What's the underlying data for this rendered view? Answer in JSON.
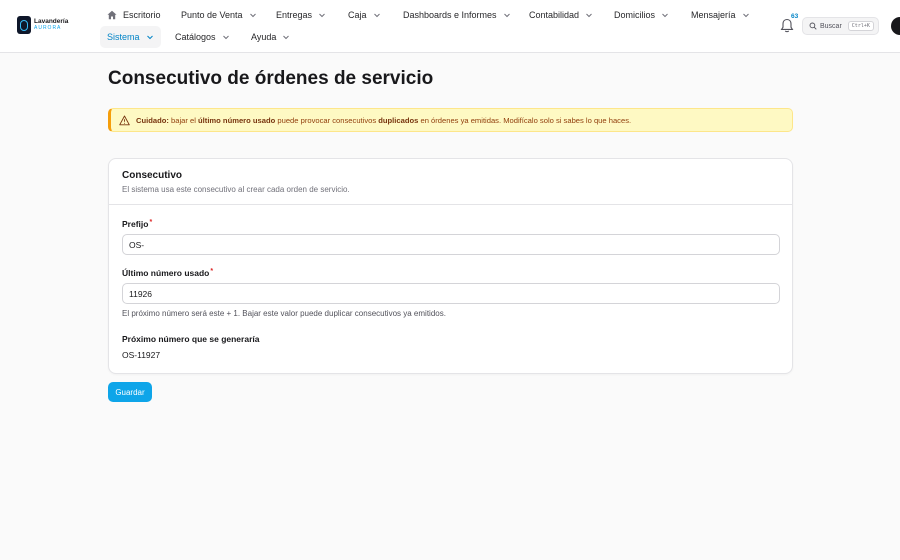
{
  "brand": {
    "line1": "Lavandería",
    "line2": "AURORA"
  },
  "nav": {
    "home": "Escritorio",
    "items": [
      "Punto de Venta",
      "Entregas",
      "Caja",
      "Dashboards e Informes",
      "Contabilidad",
      "Domicilios",
      "Mensajería",
      "Sistema",
      "Catálogos",
      "Ayuda"
    ],
    "active_item": "Sistema"
  },
  "notifications": {
    "count": "63"
  },
  "search": {
    "label": "Buscar",
    "shortcut": "Ctrl+K"
  },
  "page": {
    "title": "Consecutivo de órdenes de servicio"
  },
  "alert": {
    "prefix": "Cuidado:",
    "t1": " bajar el ",
    "strong1": "último número usado",
    "t2": " puede provocar consecutivos ",
    "strong2": "duplicados",
    "t3": " en órdenes ya emitidas. Modifícalo solo si sabes lo que haces."
  },
  "card": {
    "title": "Consecutivo",
    "description": "El sistema usa este consecutivo al crear cada orden de servicio."
  },
  "form": {
    "prefix_label": "Prefijo",
    "prefix_value": "OS-",
    "last_label": "Último número usado",
    "last_value": "11926",
    "last_hint": "El próximo número será este + 1. Bajar este valor puede duplicar consecutivos ya emitidos.",
    "next_label": "Próximo número que se generaría",
    "next_value": "OS-11927",
    "required_mark": "*"
  },
  "actions": {
    "save": "Guardar"
  },
  "colors": {
    "accent": "#0ea5e9",
    "warning_bg": "#fef9c3",
    "warning_border": "#f59e0b",
    "required": "#dc2626"
  }
}
